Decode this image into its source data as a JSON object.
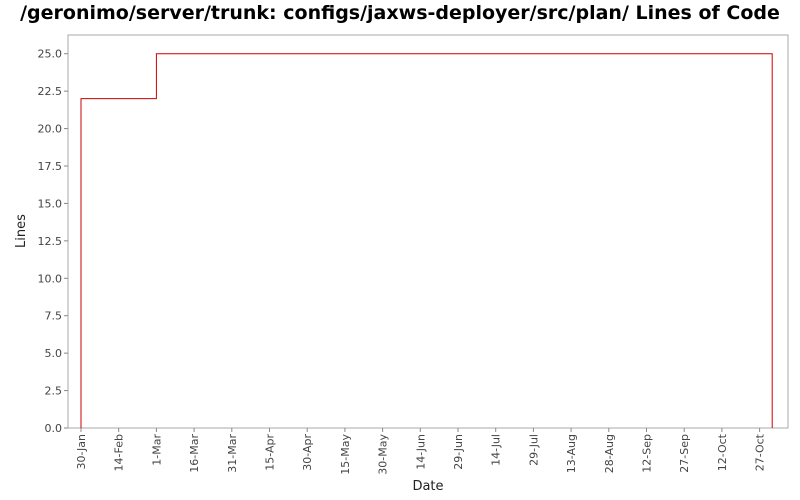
{
  "chart_data": {
    "type": "line",
    "step": true,
    "title": "/geronimo/server/trunk: configs/jaxws-deployer/src/plan/ Lines of Code",
    "xlabel": "Date",
    "ylabel": "Lines",
    "ylim": [
      0,
      26.25
    ],
    "yticks": [
      "0.0",
      "2.5",
      "5.0",
      "7.5",
      "10.0",
      "12.5",
      "15.0",
      "17.5",
      "20.0",
      "22.5",
      "25.0"
    ],
    "xticks": [
      "30-Jan",
      "14-Feb",
      "1-Mar",
      "16-Mar",
      "31-Mar",
      "15-Apr",
      "30-Apr",
      "15-May",
      "30-May",
      "14-Jun",
      "29-Jun",
      "14-Jul",
      "29-Jul",
      "13-Aug",
      "28-Aug",
      "12-Sep",
      "27-Sep",
      "12-Oct",
      "27-Oct"
    ],
    "grid": false,
    "series": [
      {
        "color": "#cc0000",
        "points": [
          {
            "x": "30-Jan",
            "y": 0
          },
          {
            "x": "30-Jan",
            "y": 22
          },
          {
            "x": "1-Mar",
            "y": 22
          },
          {
            "x": "1-Mar",
            "y": 25
          },
          {
            "x": "1-Nov",
            "y": 25
          },
          {
            "x": "1-Nov",
            "y": 0
          }
        ]
      }
    ]
  }
}
